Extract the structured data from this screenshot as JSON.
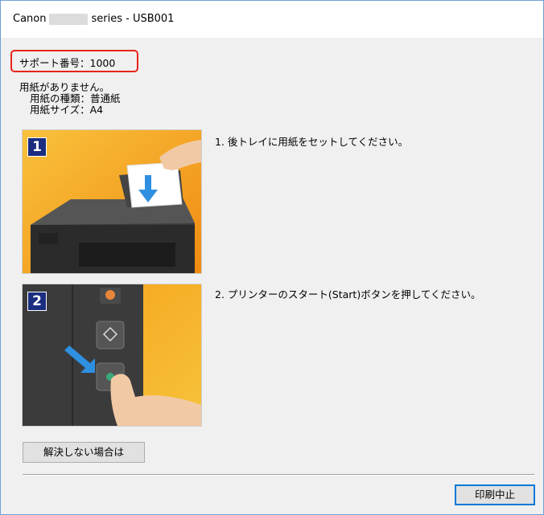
{
  "window": {
    "title_prefix": "Canon",
    "title_suffix": "series - USB001"
  },
  "support": {
    "label": "サポート番号：1000"
  },
  "message": {
    "line1": "用紙がありません。",
    "line2": "用紙の種類：普通紙",
    "line3": "用紙サイズ：A4"
  },
  "steps": [
    {
      "number": "1",
      "text": "1. 後トレイに用紙をセットしてください。"
    },
    {
      "number": "2",
      "text": "2. プリンターのスタート(Start)ボタンを押してください。"
    }
  ],
  "buttons": {
    "solve_label": "解決しない場合は",
    "cancel_label": "印刷中止"
  },
  "colors": {
    "highlight_border": "#e8231a",
    "step_badge": "#1a2d80",
    "orange_bg": "#f5a31a",
    "arrow_blue": "#2f8fe0"
  }
}
